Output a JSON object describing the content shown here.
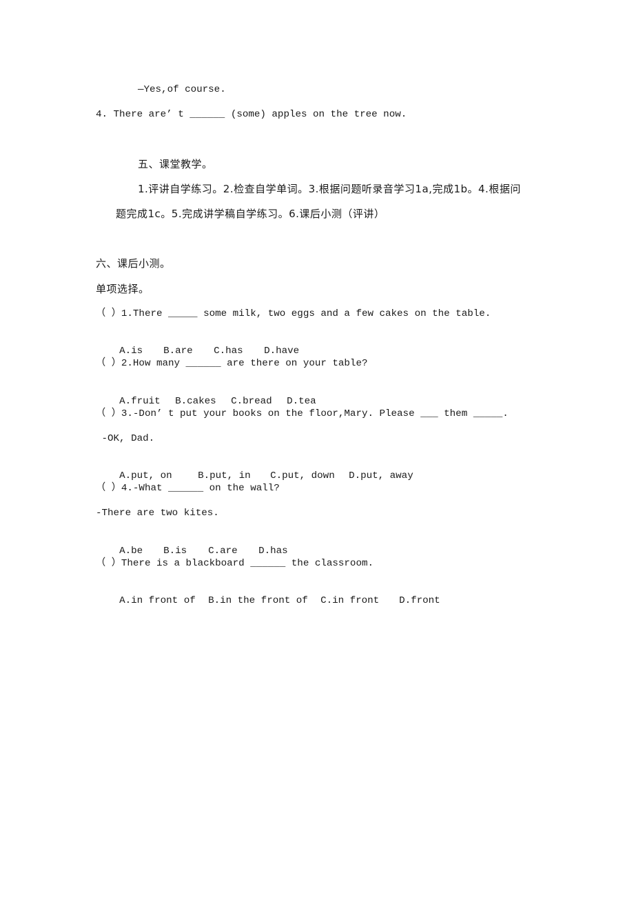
{
  "fragment": {
    "answer_line": "—Yes,of course.",
    "item4": "4. There are’ t ______ (some) apples on the tree now."
  },
  "section5": {
    "heading": "五、课堂教学。",
    "body_line1": "1.评讲自学练习。2.检查自学单词。3.根据问题听录音学习1a,完成1b。4.根据问",
    "body_line2": "题完成1c。5.完成讲学稿自学练习。6.课后小测（评讲）"
  },
  "section6": {
    "heading": "六、课后小测。",
    "subheading": "单项选择。",
    "questions": [
      {
        "stem": "（ ）1.There _____ some milk, two eggs and a few cakes on the table.",
        "options": [
          "A.is",
          "B.are",
          "C.has",
          "D.have"
        ]
      },
      {
        "stem": "（ ）2.How many ______ are there on your table?",
        "options": [
          "A.fruit",
          "B.cakes",
          "C.bread",
          "D.tea"
        ]
      },
      {
        "stem": "（ ）3.-Don’ t put your books on the floor,Mary. Please ___ them _____.",
        "reply": " -OK, Dad.",
        "options": [
          "A.put, on",
          "B.put, in",
          "C.put, down",
          "D.put, away"
        ]
      },
      {
        "stem": "（ ）4.-What ______ on the wall?",
        "reply": "-There are two kites.",
        "options": [
          "A.be",
          "B.is",
          "C.are",
          "D.has"
        ]
      },
      {
        "stem": "（ ）There is a blackboard ______ the classroom.",
        "options": [
          "A.in front of",
          "B.in the front of",
          "C.in front",
          "D.front"
        ]
      }
    ]
  }
}
